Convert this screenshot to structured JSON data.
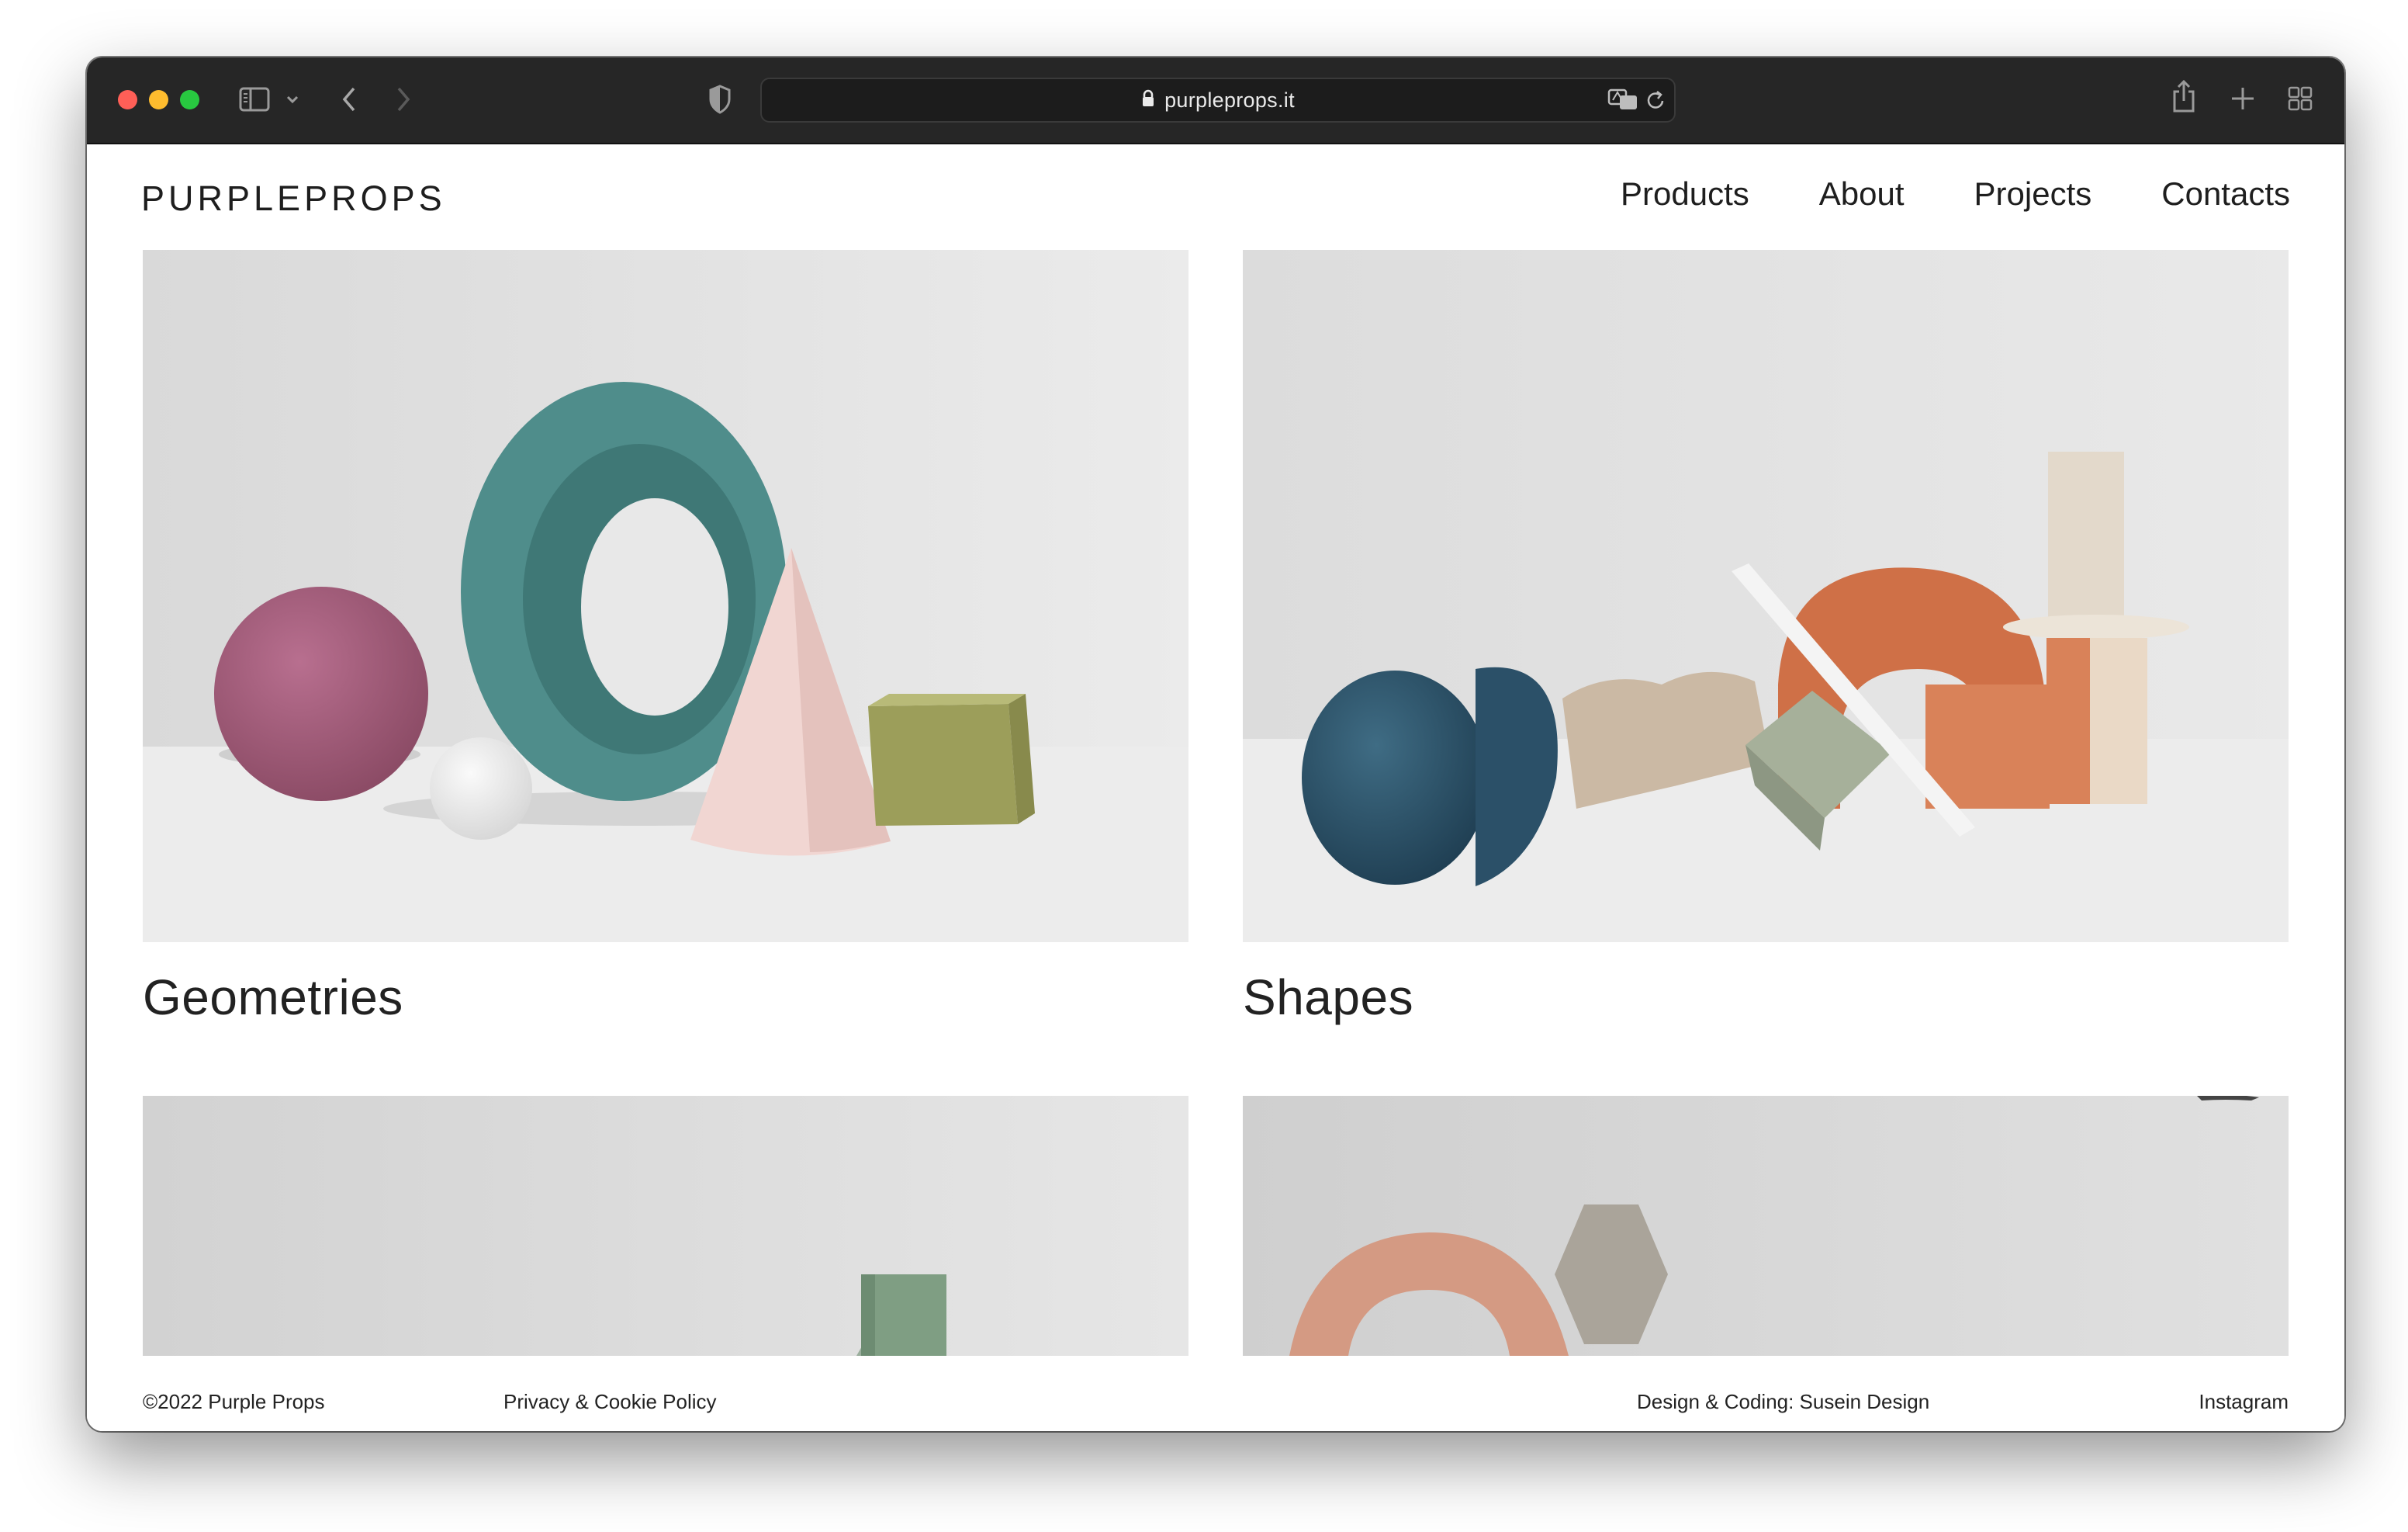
{
  "browser": {
    "url": "purpleprops.it",
    "icons": [
      "sidebar-icon",
      "chevron-down-icon",
      "back-icon",
      "forward-icon",
      "shield-icon",
      "lock-icon",
      "translate-icon",
      "reload-icon",
      "share-icon",
      "new-tab-icon",
      "tab-overview-icon"
    ]
  },
  "header": {
    "logo": "PURPLEPROPS",
    "nav": [
      "Products",
      "About",
      "Projects",
      "Contacts"
    ]
  },
  "cards": [
    {
      "title": "Geometries"
    },
    {
      "title": "Shapes"
    },
    {
      "title": ""
    },
    {
      "title": ""
    }
  ],
  "footer": {
    "copyright": "©2022 Purple Props",
    "privacy": "Privacy & Cookie Policy",
    "credits": "Design & Coding: Susein Design",
    "instagram": "Instagram"
  },
  "colors": {
    "toolbar": "#262626",
    "photo_background": "#e6e6e6",
    "text": "#1e1e1e"
  }
}
